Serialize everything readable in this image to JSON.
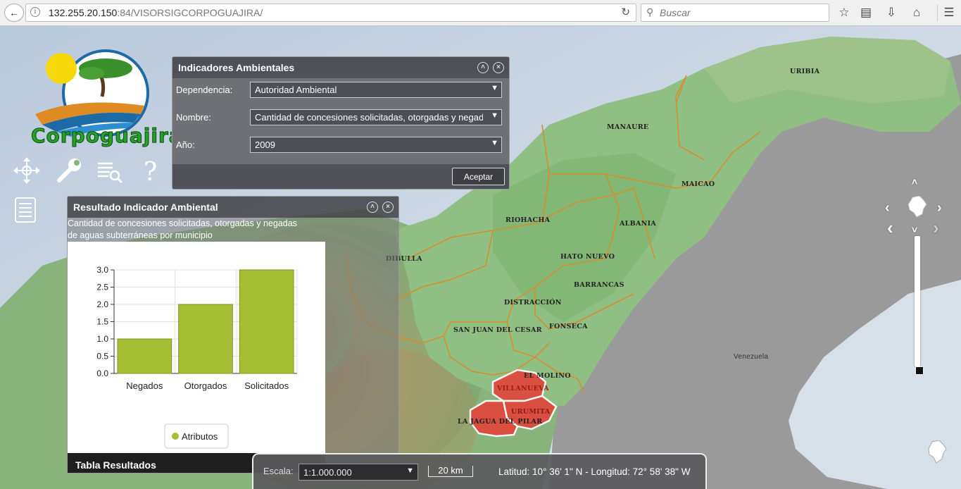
{
  "browser": {
    "url_host": "132.255.20.150",
    "url_path": ":84/VISORSIGCORPOGUAJIRA/",
    "search_placeholder": "Buscar",
    "icons": [
      "back-icon",
      "info-icon",
      "reload-icon",
      "search-icon",
      "star-icon",
      "reader-icon",
      "download-icon",
      "home-icon",
      "menu-icon"
    ]
  },
  "logo": {
    "text": "Corpoguajira"
  },
  "tools": [
    "move-icon",
    "wrench-icon",
    "list-search-icon",
    "help-icon",
    "layers-list-icon"
  ],
  "indicators_dialog": {
    "title": "Indicadores Ambientales",
    "fields": [
      {
        "label": "Dependencia:",
        "value": "Autoridad Ambiental"
      },
      {
        "label": "Nombre:",
        "value": "Cantidad de concesiones solicitadas, otorgadas  y negadas de aguas subterráneas por municipio"
      },
      {
        "label": "Año:",
        "value": "2009"
      }
    ],
    "accept_label": "Aceptar"
  },
  "results_dialog": {
    "title": "Resultado Indicador Ambiental",
    "description_line1": "Cantidad de concesiones solicitadas, otorgadas  y negadas",
    "description_line2": "de aguas subterráneas  por municipio",
    "table_label": "Tabla Resultados"
  },
  "chart_data": {
    "type": "bar",
    "categories": [
      "Negados",
      "Otorgados",
      "Solicitados"
    ],
    "series": [
      {
        "name": "Atributos",
        "values": [
          1,
          2,
          3
        ]
      }
    ],
    "ylim": [
      0,
      3
    ],
    "yticks": [
      "3.0",
      "2.5",
      "2.0",
      "1.5",
      "1.0",
      "0.5",
      "0.0"
    ],
    "ytick_values": [
      3.0,
      2.5,
      2.0,
      1.5,
      1.0,
      0.5,
      0.0
    ],
    "grid": true,
    "legend": "bottom-center",
    "bar_color": "#a6be34"
  },
  "map_labels": {
    "uribia": "URIBIA",
    "manaure": "MANAURE",
    "maicao": "MAICAO",
    "riohacha": "RIOHACHA",
    "albania": "ALBANIA",
    "dibulla": "DIBULLA",
    "hato_nuevo": "HATO NUEVO",
    "barrancas": "BARRANCAS",
    "distraccion": "DISTRACCIÓN",
    "san_juan": "SAN JUAN DEL CESAR",
    "fonseca": "FONSECA",
    "el_molino": "EL MOLINO",
    "villanueva": "VILLANUEVA",
    "urumita": "URUMITA",
    "la_jagua": "LA JAGUA DEL PILAR",
    "venezuela": "Venezuela"
  },
  "highlight_color": "#e0463c",
  "bottom_bar": {
    "scale_label": "Escala:",
    "scale_value": "1:1.000.000",
    "scalebar_text": "20 km",
    "coordinates": "Latitud: 10° 36' 1\" N - Longitud: 72° 58' 38\" W"
  }
}
